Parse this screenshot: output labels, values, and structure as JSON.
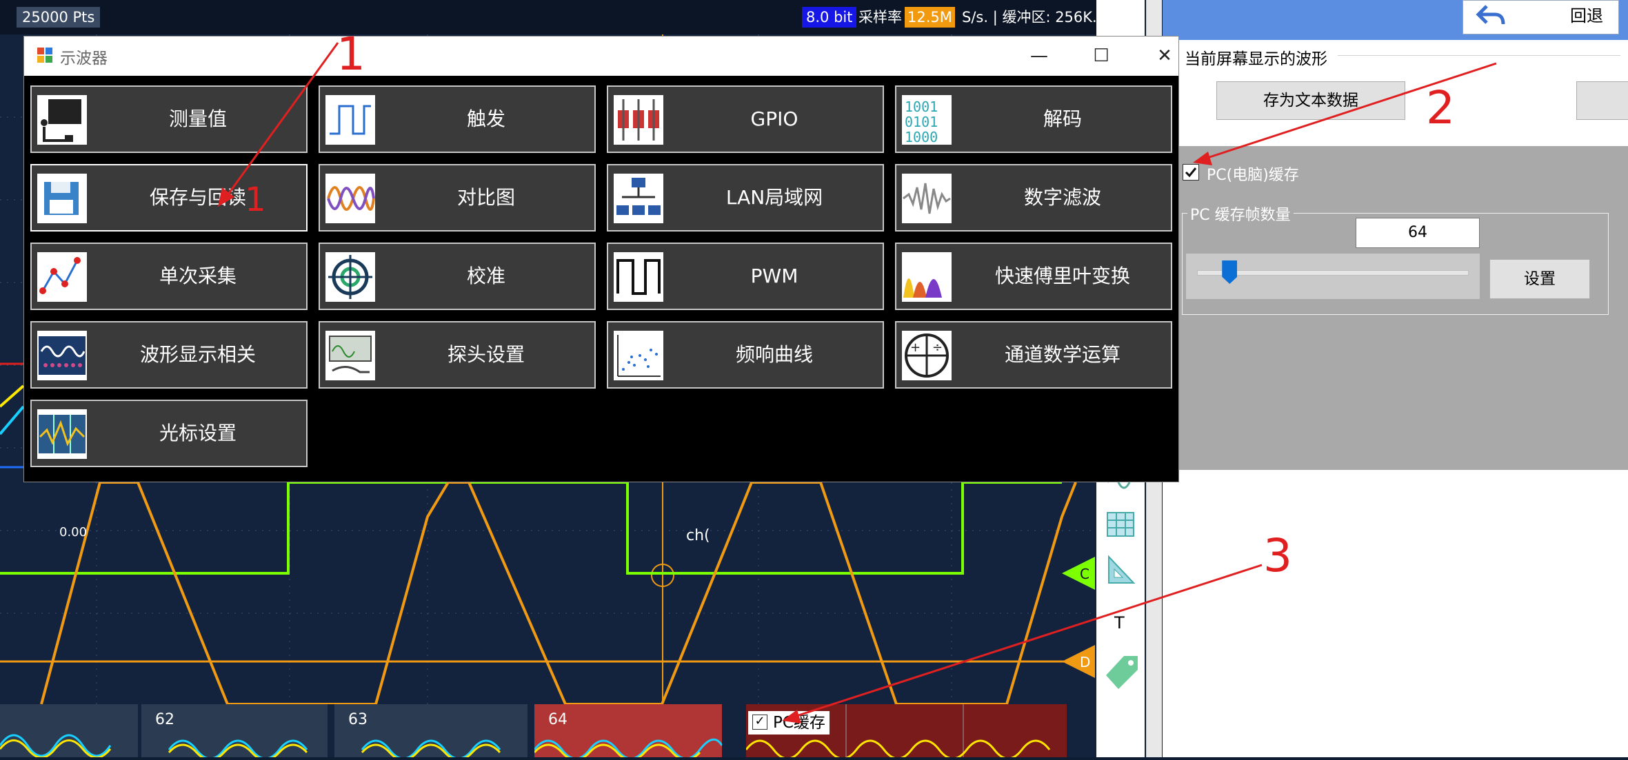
{
  "status_bar": {
    "points": "25000 Pts",
    "bit_depth": "8.0 bit",
    "sample_rate_label": "采样率",
    "sample_rate_value": "12.5M",
    "sample_rate_unit": "S/s. | 缓冲区: 256K."
  },
  "waveform": {
    "ch_label": "ch(",
    "marker_c": "C",
    "marker_d": "D",
    "offset_text": "0.00"
  },
  "toolbar": {
    "t_label": "T"
  },
  "dialog": {
    "title": "示波器",
    "controls": {
      "minimize": "—",
      "maximize": "☐",
      "close": "✕"
    },
    "tiles": [
      {
        "label": "测量值",
        "icon": "measure-icon"
      },
      {
        "label": "触发",
        "icon": "trigger-icon"
      },
      {
        "label": "GPIO",
        "icon": "gpio-icon"
      },
      {
        "label": "解码",
        "icon": "decode-icon"
      },
      {
        "label": "保存与回读",
        "icon": "floppy-icon"
      },
      {
        "label": "对比图",
        "icon": "compare-icon"
      },
      {
        "label": "LAN局域网",
        "icon": "lan-icon"
      },
      {
        "label": "数字滤波",
        "icon": "filter-icon"
      },
      {
        "label": "单次采集",
        "icon": "single-capture-icon"
      },
      {
        "label": "校准",
        "icon": "calibrate-icon"
      },
      {
        "label": "PWM",
        "icon": "pwm-icon"
      },
      {
        "label": "快速傅里叶变换",
        "icon": "fft-icon"
      },
      {
        "label": "波形显示相关",
        "icon": "waveform-display-icon"
      },
      {
        "label": "探头设置",
        "icon": "probe-icon"
      },
      {
        "label": "频响曲线",
        "icon": "freq-response-icon"
      },
      {
        "label": "通道数学运算",
        "icon": "math-icon"
      },
      {
        "label": "光标设置",
        "icon": "cursor-icon"
      }
    ]
  },
  "right_panel": {
    "back_label": "回退",
    "current_wave_title": "当前屏幕显示的波形",
    "save_text_button": "存为文本数据",
    "pc_cache_label": "PC(电脑)缓存",
    "frames_group_title": "PC 缓存帧数量",
    "frames_value": "64",
    "frames_fraction": 0.12,
    "set_button": "设置"
  },
  "bottom_strip": {
    "frames": [
      "62",
      "63",
      "64"
    ],
    "pc_cache_label": "PC缓存"
  },
  "annotations": [
    "1",
    "1",
    "2",
    "3"
  ],
  "colors": {
    "scope_bg": "#13233d",
    "green_trace": "#7cff00",
    "orange_trace": "#f09a14",
    "annotation_red": "#e02020",
    "dialog_bg": "#000000",
    "tile_bg": "#3a3a3a"
  }
}
